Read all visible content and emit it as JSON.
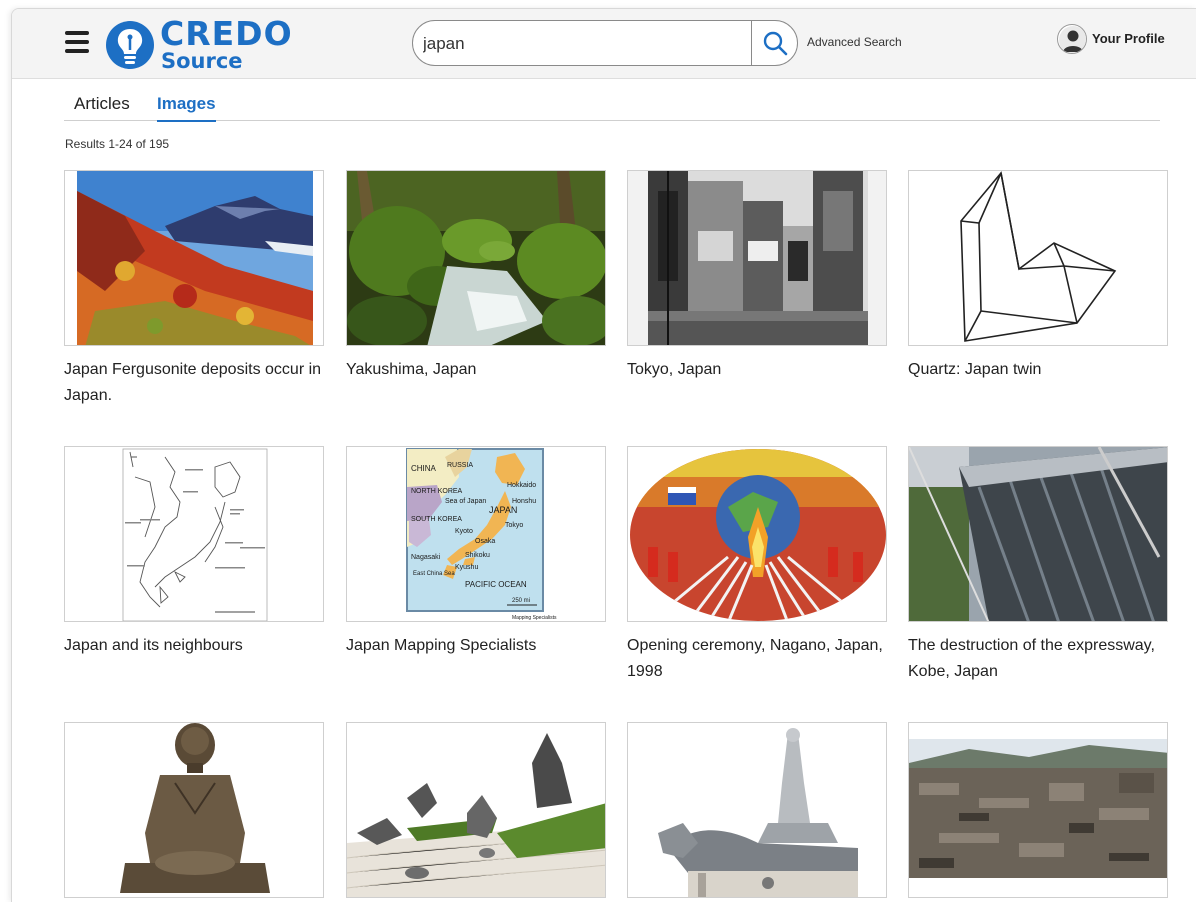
{
  "header": {
    "logo_top": "CREDO",
    "logo_bottom": "Source",
    "search_value": "japan",
    "advanced_search": "Advanced Search",
    "profile_label": "Your Profile"
  },
  "tabs": [
    {
      "label": "Articles",
      "active": false
    },
    {
      "label": "Images",
      "active": true
    }
  ],
  "results_count": "Results 1-24 of 195",
  "images": [
    {
      "caption": "Japan Fergusonite deposits occur in Japan."
    },
    {
      "caption": "Yakushima, Japan"
    },
    {
      "caption": "Tokyo, Japan"
    },
    {
      "caption": "Quartz: Japan twin"
    },
    {
      "caption": "Japan and its neighbours"
    },
    {
      "caption": "Japan Mapping Specialists"
    },
    {
      "caption": "Opening ceremony, Nagano, Japan, 1998"
    },
    {
      "caption": "The destruction of the expressway, Kobe, Japan"
    },
    {
      "caption": ""
    },
    {
      "caption": ""
    },
    {
      "caption": ""
    },
    {
      "caption": ""
    }
  ],
  "map_labels": {
    "china": "CHINA",
    "russia": "RUSSIA",
    "north_korea": "NORTH KOREA",
    "south_korea": "SOUTH KOREA",
    "sea_of_japan": "Sea of Japan",
    "japan": "JAPAN",
    "hokkaido": "Hokkaido",
    "honshu": "Honshu",
    "tokyo": "Tokyo",
    "kyoto": "Kyoto",
    "osaka": "Osaka",
    "shikoku": "Shikoku",
    "kyushu": "Kyushu",
    "nagasaki": "Nagasaki",
    "east_china_sea": "East China Sea",
    "pacific": "PACIFIC OCEAN",
    "scale": "250 mi",
    "credit": "Mapping Specialists"
  },
  "colors": {
    "brand": "#1d6fc4",
    "header_bg": "#f4f4f4"
  }
}
